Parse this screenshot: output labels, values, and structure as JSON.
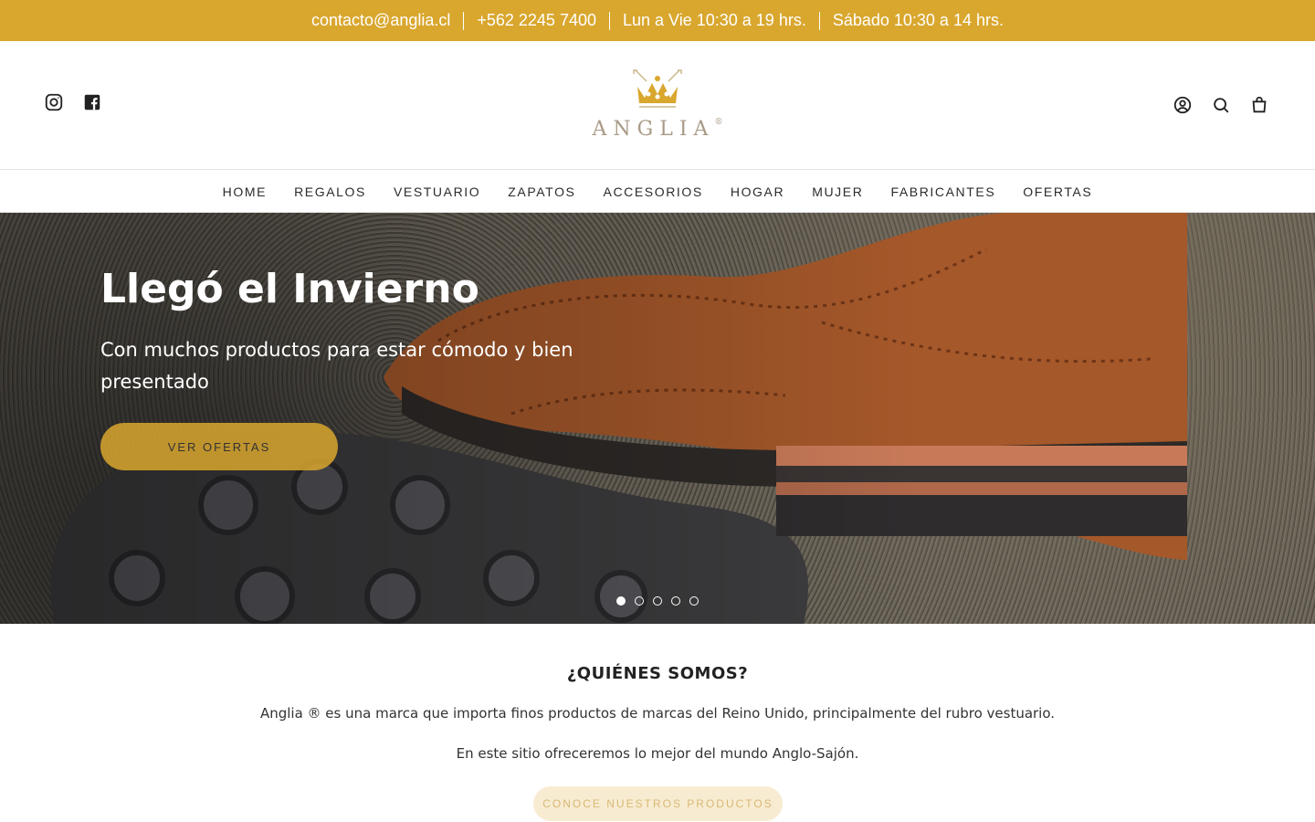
{
  "topbar": {
    "email": "contacto@anglia.cl",
    "phone": "+562 2245 7400",
    "hours_weekday": "Lun a Vie 10:30 a 19 hrs.",
    "hours_saturday": "Sábado 10:30 a 14 hrs."
  },
  "header": {
    "logo_text": "ANGLIA",
    "logo_mark": "®",
    "social_icons": [
      "instagram-icon",
      "facebook-icon"
    ],
    "utility_icons": [
      "account-icon",
      "search-icon",
      "cart-icon"
    ]
  },
  "nav": {
    "items": [
      "HOME",
      "REGALOS",
      "VESTUARIO",
      "ZAPATOS",
      "ACCESORIOS",
      "HOGAR",
      "MUJER",
      "FABRICANTES",
      "OFERTAS"
    ]
  },
  "hero": {
    "title": "Llegó el Invierno",
    "subtitle": "Con muchos productos para estar cómodo y bien presentado",
    "button_label": "VER OFERTAS",
    "slide_count": 5,
    "active_slide": 1
  },
  "about": {
    "title": "¿QUIÉNES SOMOS?",
    "paragraph1": "Anglia ® es una marca que importa finos productos de marcas del Reino Unido, principalmente del rubro vestuario.",
    "paragraph2": "En este sitio ofreceremos lo mejor del mundo Anglo-Sajón.",
    "button_label": "CONOCE NUESTROS PRODUCTOS"
  },
  "colors": {
    "brand_gold": "#d9a72e",
    "button_soft": "#f7ecd2"
  }
}
